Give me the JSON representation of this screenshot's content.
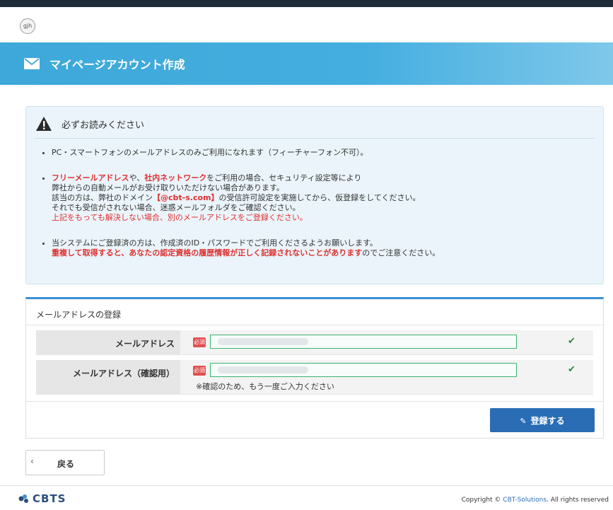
{
  "header": {
    "logo_text": "gjh"
  },
  "banner": {
    "title": "マイページアカウント作成"
  },
  "notice": {
    "title": "必ずお読みください",
    "item1": "PC・スマートフォンのメールアドレスのみご利用になれます（フィーチャーフォン不可）。",
    "item2": {
      "free_mail": "フリーメールアドレス",
      "part1": "や、",
      "internal_network": "社内ネットワーク",
      "part2": "をご利用の場合、セキュリティ設定等により",
      "line2": "弊社からの自動メールがお受け取りいただけない場合があります。",
      "line3_pre": "該当の方は、弊社のドメイン",
      "domain": "【@cbt-s.com】",
      "line3_post": "の受信許可設定を実施してから、仮登録をしてください。",
      "line4": "それでも受信がされない場合、迷惑メールフォルダをご確認ください。",
      "line5": "上記をもっても解決しない場合、別のメールアドレスをご登録ください。"
    },
    "item3": {
      "line1": "当システムにご登録済の方は、作成済のID・パスワードでご利用くださるようお願いします。",
      "warning": "重複して取得すると、あなたの認定資格の履歴情報が正しく記録されないことがあります",
      "suffix": "のでご注意ください。"
    }
  },
  "form": {
    "title": "メールアドレスの登録",
    "email_label": "メールアドレス",
    "confirm_label": "メールアドレス（確認用）",
    "required_badge": "必須",
    "confirm_hint": "※確認のため、もう一度ご入力ください",
    "check_mark": "✔",
    "submit_label": "登録する"
  },
  "nav": {
    "back_label": "戻る",
    "chevron": "‹"
  },
  "footer": {
    "brand": "CBTS",
    "copyright_pre": "Copyright © ",
    "copyright_link": "CBT-Solutions",
    "copyright_post": ". All rights reserved"
  },
  "colors": {
    "accent": "#2a6db5",
    "banner": "#45aee0",
    "required": "#e05050",
    "warning": "#e03030",
    "valid": "#2e8b3d"
  }
}
